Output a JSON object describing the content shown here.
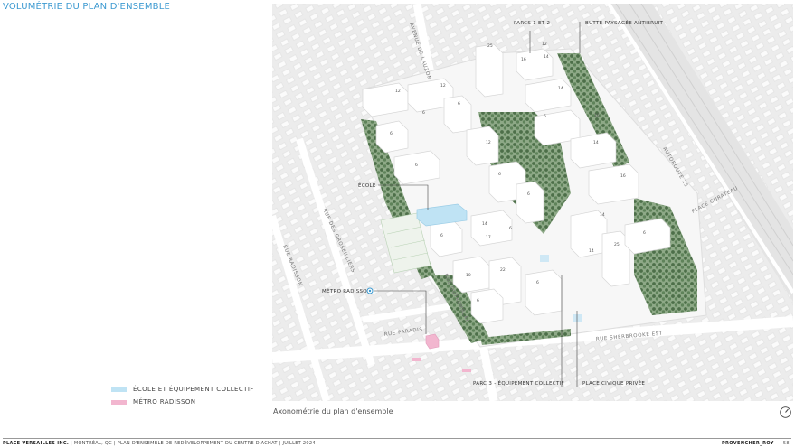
{
  "page": {
    "title": "VOLUMÉTRIE DU PLAN D'ENSEMBLE"
  },
  "colors": {
    "accent": "#3d9ad1",
    "ecole": "#bfe3f4",
    "metro": "#f2b6cf",
    "vegetation": "#5d7f58",
    "building": "#ffffff"
  },
  "legend": [
    {
      "label": "ÉCOLE ET ÉQUIPEMENT COLLECTIF",
      "color": "#bfe3f4"
    },
    {
      "label": "MÉTRO RADISSON",
      "color": "#f2b6cf"
    }
  ],
  "map": {
    "labels": {
      "parcs": "PARCS 1 ET 2",
      "butte": "BUTTE PAYSAGÉE ANTIBRUIT",
      "ecole": "ÉCOLE",
      "metro": "MÉTRO RADISSON",
      "parc3": "PARC 3 - ÉQUIPEMENT COLLECTIF",
      "place": "PLACE CIVIQUE PRIVÉE"
    },
    "streets": {
      "lauzon": "AVENUE DE LAUZON",
      "groseilliers": "RUE DES GROSEILLIERS",
      "radisson": "RUE RADISSON",
      "paradis": "RUE PARADIS",
      "dutremblay": "RUE DUTREMBLAY",
      "autoroute": "AUTOROUTE 25",
      "curateau": "PLACE CURATEAU",
      "sherbrooke": "RUE SHERBROOKE EST"
    },
    "heights": [
      "25",
      "16",
      "14",
      "12",
      "12",
      "6",
      "12",
      "14",
      "6",
      "6",
      "16",
      "14",
      "6",
      "6",
      "25",
      "14",
      "12",
      "6",
      "16",
      "14",
      "6",
      "14",
      "17",
      "6",
      "10",
      "6",
      "6",
      "22",
      "6",
      "6"
    ]
  },
  "caption": "Axonométrie du plan d'ensemble",
  "footer": {
    "company": "PLACE VERSAILLES INC.",
    "details": "  |  MONTRÉAL, QC  |  PLAN D'ENSEMBLE DE REDÉVELOPPEMENT DU CENTRE D'ACHAT  |  JUILLET 2024",
    "firm": "PROVENCHER_ROY",
    "page_number": "58"
  }
}
